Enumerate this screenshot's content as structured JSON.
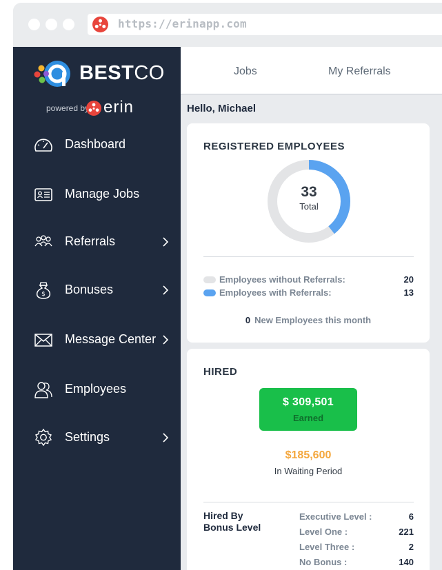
{
  "browser": {
    "url": "https://erinapp.com"
  },
  "sidebar": {
    "brand_bold": "BEST",
    "brand_light": "CO",
    "powered_by": "powered by",
    "erin_word": "erin",
    "items": [
      {
        "label": "Dashboard",
        "icon": "dashboard-gauge-icon",
        "has_chevron": false
      },
      {
        "label": "Manage Jobs",
        "icon": "id-card-icon",
        "has_chevron": false
      },
      {
        "label": "Referrals",
        "icon": "people-group-icon",
        "has_chevron": true
      },
      {
        "label": "Bonuses",
        "icon": "money-bag-icon",
        "has_chevron": true
      },
      {
        "label": "Message Center",
        "icon": "envelope-icon",
        "has_chevron": true
      },
      {
        "label": "Employees",
        "icon": "employees-icon",
        "has_chevron": false
      },
      {
        "label": "Settings",
        "icon": "gear-icon",
        "has_chevron": true
      }
    ]
  },
  "topbar": {
    "tabs": [
      {
        "label": "Jobs"
      },
      {
        "label": "My Referrals"
      }
    ]
  },
  "main": {
    "greeting": "Hello, Michael",
    "registered": {
      "title": "REGISTERED EMPLOYEES",
      "total_value": "33",
      "total_label": "Total",
      "legend": [
        {
          "label": "Employees without Referrals:",
          "value": "20",
          "color": "#e3e4e6"
        },
        {
          "label": "Employees with Referrals:",
          "value": "13",
          "color": "#5aa3f0"
        }
      ],
      "new_count": "0",
      "new_label": "New Employees this month",
      "with_referrals_fraction": 0.394
    },
    "hired": {
      "title": "HIRED",
      "earned_amount": "$ 309,501",
      "earned_label": "Earned",
      "waiting_amount": "$185,600",
      "waiting_label": "In Waiting Period",
      "hired_by_line1": "Hired By",
      "hired_by_line2": "Bonus Level",
      "levels": [
        {
          "label": "Executive Level :",
          "value": "6"
        },
        {
          "label": "Level One :",
          "value": "221"
        },
        {
          "label": "Level Three :",
          "value": "2"
        },
        {
          "label": "No Bonus :",
          "value": "140"
        }
      ]
    }
  },
  "colors": {
    "sidebar_bg": "#1f2a3d",
    "accent_blue": "#5aa3f0",
    "earned_green": "#19bf4a",
    "waiting_orange": "#f4a73d",
    "erin_red": "#e8453c"
  }
}
